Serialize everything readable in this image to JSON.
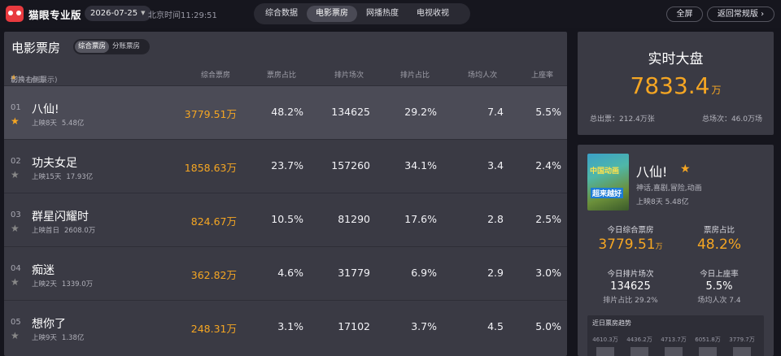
{
  "app": {
    "logo_text": "猫眼专业版",
    "date": "2026-07-25",
    "beijing_time": "北京时间11:29:51"
  },
  "tabs": [
    "综合数据",
    "电影票房",
    "网播热度",
    "电视收视"
  ],
  "active_tab": 1,
  "actions": {
    "fullscreen": "全屏",
    "back": "返回常规版"
  },
  "main": {
    "title": "电影票房",
    "subtoggle": [
      "综合票房",
      "分账票房"
    ],
    "columns": {
      "film_prefix": "影片 (点击",
      "film_suffix": "切换右侧展示)",
      "box": "综合票房",
      "box_share": "票房占比",
      "shows": "排片场次",
      "show_share": "排片占比",
      "avg_people": "场均人次",
      "occupancy": "上座率"
    },
    "rows": [
      {
        "rank": "01",
        "name": "八仙!",
        "days": "上映8天",
        "total": "5.48亿",
        "box": "3779.51万",
        "box_share": "48.2%",
        "shows": "134625",
        "show_share": "29.2%",
        "avg": "7.4",
        "occ": "5.5%",
        "starred": true
      },
      {
        "rank": "02",
        "name": "功夫女足",
        "days": "上映15天",
        "total": "17.93亿",
        "box": "1858.63万",
        "box_share": "23.7%",
        "shows": "157260",
        "show_share": "34.1%",
        "avg": "3.4",
        "occ": "2.4%",
        "starred": false
      },
      {
        "rank": "03",
        "name": "群星闪耀时",
        "days": "上映首日",
        "total": "2608.0万",
        "box": "824.67万",
        "box_share": "10.5%",
        "shows": "81290",
        "show_share": "17.6%",
        "avg": "2.8",
        "occ": "2.5%",
        "starred": false
      },
      {
        "rank": "04",
        "name": "痴迷",
        "days": "上映2天",
        "total": "1339.0万",
        "box": "362.82万",
        "box_share": "4.6%",
        "shows": "31779",
        "show_share": "6.9%",
        "avg": "2.9",
        "occ": "3.0%",
        "starred": false
      },
      {
        "rank": "05",
        "name": "想你了",
        "days": "上映9天",
        "total": "1.38亿",
        "box": "248.31万",
        "box_share": "3.1%",
        "shows": "17102",
        "show_share": "3.7%",
        "avg": "4.5",
        "occ": "5.0%",
        "starred": false
      }
    ]
  },
  "realtime": {
    "title": "实时大盘",
    "value": "7833.4",
    "unit": "万",
    "total_tickets": "总出票：212.4万张",
    "total_shows": "总场次：46.0万场"
  },
  "detail": {
    "poster_text_1": "中国动画",
    "poster_text_2": "超来越好",
    "name": "八仙!",
    "genre": "神话,喜剧,冒险,动画",
    "days": "上映8天  5.48亿",
    "today_box_label": "今日综合票房",
    "today_box": "3779.51",
    "today_box_unit": "万",
    "box_share_label": "票房占比",
    "box_share": "48.2%",
    "shows_label": "今日排片场次",
    "shows": "134625",
    "show_share": "排片占比 29.2%",
    "occ_label": "今日上座率",
    "occ": "5.5%",
    "avg": "场均人次 7.4",
    "trend_title": "近日票房趋势",
    "trend_values": [
      "4610.3万",
      "4436.2万",
      "4713.7万",
      "6051.8万",
      "3779.7万"
    ]
  },
  "colors": {
    "accent": "#f5a623",
    "panel": "#3a3a44",
    "background": "#15151d"
  }
}
